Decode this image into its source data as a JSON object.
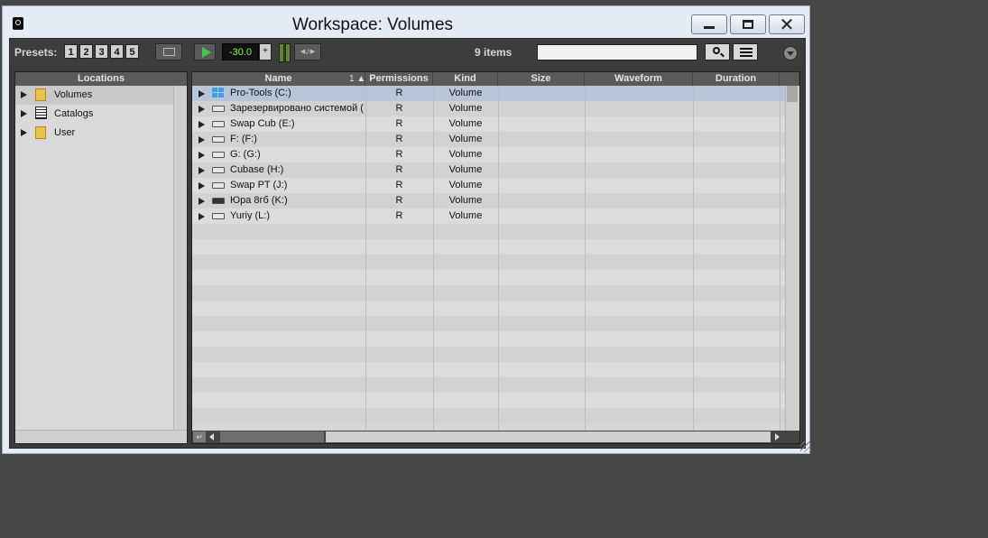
{
  "window": {
    "title": "Workspace: Volumes"
  },
  "toolbar": {
    "presets_label": "Presets:",
    "presets": [
      "1",
      "2",
      "3",
      "4",
      "5"
    ],
    "level_value": "-30.0",
    "items_count": "9 items",
    "search_placeholder": ""
  },
  "locations": {
    "header": "Locations",
    "items": [
      {
        "label": "Volumes",
        "icon": "folder-icon",
        "selected": true
      },
      {
        "label": "Catalogs",
        "icon": "catalog-icon",
        "selected": false
      },
      {
        "label": "User",
        "icon": "folder-icon",
        "selected": false
      }
    ]
  },
  "browser": {
    "columns": [
      {
        "label": "Name"
      },
      {
        "label": "Permissions"
      },
      {
        "label": "Kind"
      },
      {
        "label": "Size"
      },
      {
        "label": "Waveform"
      },
      {
        "label": "Duration"
      }
    ],
    "sort_indicator": "1 ▲",
    "rows": [
      {
        "name": "Pro-Tools (C:)",
        "permissions": "R",
        "kind": "Volume",
        "icon": "windows-drive-icon"
      },
      {
        "name": "Зарезервировано системой (",
        "permissions": "R",
        "kind": "Volume",
        "icon": "drive-icon"
      },
      {
        "name": "Swap Cub (E:)",
        "permissions": "R",
        "kind": "Volume",
        "icon": "drive-icon"
      },
      {
        "name": "F: (F:)",
        "permissions": "R",
        "kind": "Volume",
        "icon": "drive-icon"
      },
      {
        "name": "G: (G:)",
        "permissions": "R",
        "kind": "Volume",
        "icon": "drive-icon"
      },
      {
        "name": "Cubase (H:)",
        "permissions": "R",
        "kind": "Volume",
        "icon": "drive-icon"
      },
      {
        "name": "Swap PT (J:)",
        "permissions": "R",
        "kind": "Volume",
        "icon": "drive-icon"
      },
      {
        "name": "Юра 8гб (K:)",
        "permissions": "R",
        "kind": "Volume",
        "icon": "usb-drive-icon"
      },
      {
        "name": "Yuriy (L:)",
        "permissions": "R",
        "kind": "Volume",
        "icon": "drive-icon"
      }
    ]
  }
}
